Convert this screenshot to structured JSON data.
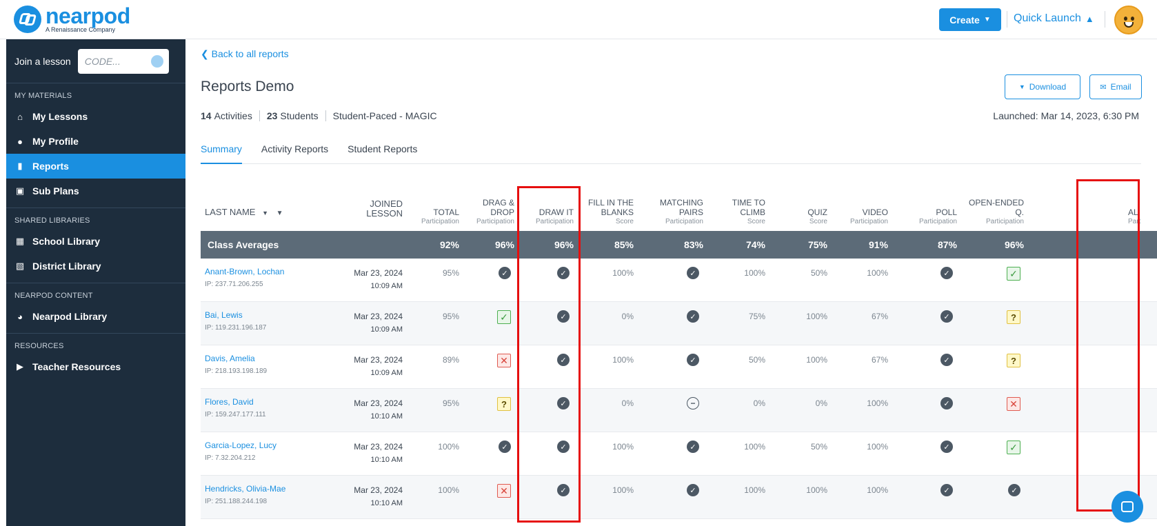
{
  "brand": {
    "name": "nearpod",
    "tagline": "A Renaissance Company"
  },
  "header": {
    "create_label": "Create",
    "quick_launch_label": "Quick Launch"
  },
  "sidebar": {
    "join_label": "Join a lesson",
    "code_placeholder": "CODE...",
    "sections": {
      "my_materials": "MY MATERIALS",
      "shared": "SHARED LIBRARIES",
      "content": "NEARPOD CONTENT",
      "resources": "RESOURCES"
    },
    "items": {
      "my_lessons": "My Lessons",
      "my_profile": "My Profile",
      "reports": "Reports",
      "sub_plans": "Sub Plans",
      "school_library": "School Library",
      "district_library": "District Library",
      "nearpod_library": "Nearpod Library",
      "teacher_resources": "Teacher Resources"
    },
    "active_item": "Reports"
  },
  "report": {
    "back_label": "Back to all reports",
    "title": "Reports Demo",
    "activities_count": "14",
    "activities_label": "Activities",
    "students_count": "23",
    "students_label": "Students",
    "mode": "Student-Paced - MAGIC",
    "launched": "Launched: Mar 14, 2023, 6:30 PM",
    "download_label": "Download",
    "email_label": "Email"
  },
  "tabs": [
    {
      "label": "Summary",
      "active": true
    },
    {
      "label": "Activity Reports",
      "active": false
    },
    {
      "label": "Student Reports",
      "active": false
    }
  ],
  "table": {
    "headers": {
      "last_name": "LAST NAME",
      "joined": "JOINED LESSON",
      "total": "TOTAL",
      "total_sub": "Participation",
      "drag": "DRAG & DROP",
      "drag_sub": "Participation",
      "draw": "DRAW IT",
      "draw_sub": "Participation",
      "fill": "FILL IN THE BLANKS",
      "fill_sub": "Score",
      "match": "MATCHING PAIRS",
      "match_sub": "Participation",
      "climb": "TIME TO CLIMB",
      "climb_sub": "Score",
      "quiz": "QUIZ",
      "quiz_sub": "Score",
      "video": "VIDEO",
      "video_sub": "Participation",
      "poll": "POLL",
      "poll_sub": "Participation",
      "open": "OPEN-ENDED Q.",
      "open_sub": "Participation",
      "partial": "AL",
      "partial_sub": "Part"
    },
    "averages": {
      "label": "Class Averages",
      "total": "92%",
      "drag": "96%",
      "draw": "96%",
      "fill": "85%",
      "match": "83%",
      "climb": "74%",
      "quiz": "75%",
      "video": "91%",
      "poll": "87%",
      "open": "96%"
    },
    "rows": [
      {
        "name": "Anant-Brown, Lochan",
        "ip": "IP: 237.71.206.255",
        "date": "Mar 23, 2024",
        "time": "10:09 AM",
        "total": "95%",
        "drag": "check",
        "draw": "check",
        "fill": "100%",
        "match": "check",
        "climb": "100%",
        "quiz": "50%",
        "video": "100%",
        "poll": "check",
        "open": "correct"
      },
      {
        "name": "Bai, Lewis",
        "ip": "IP: 119.231.196.187",
        "date": "Mar 23, 2024",
        "time": "10:09 AM",
        "total": "95%",
        "drag": "correct",
        "draw": "check",
        "fill": "0%",
        "match": "check",
        "climb": "75%",
        "quiz": "100%",
        "video": "67%",
        "poll": "check",
        "open": "unknown"
      },
      {
        "name": "Davis, Amelia",
        "ip": "IP: 218.193.198.189",
        "date": "Mar 23, 2024",
        "time": "10:09 AM",
        "total": "89%",
        "drag": "wrong",
        "draw": "check",
        "fill": "100%",
        "match": "check",
        "climb": "50%",
        "quiz": "100%",
        "video": "67%",
        "poll": "check",
        "open": "unknown"
      },
      {
        "name": "Flores, David",
        "ip": "IP: 159.247.177.111",
        "date": "Mar 23, 2024",
        "time": "10:10 AM",
        "total": "95%",
        "drag": "unknown",
        "draw": "check",
        "fill": "0%",
        "match": "skip",
        "climb": "0%",
        "quiz": "0%",
        "video": "100%",
        "poll": "check",
        "open": "wrong"
      },
      {
        "name": "Garcia-Lopez, Lucy",
        "ip": "IP: 7.32.204.212",
        "date": "Mar 23, 2024",
        "time": "10:10 AM",
        "total": "100%",
        "drag": "check",
        "draw": "check",
        "fill": "100%",
        "match": "check",
        "climb": "100%",
        "quiz": "50%",
        "video": "100%",
        "poll": "check",
        "open": "correct"
      },
      {
        "name": "Hendricks, Olivia-Mae",
        "ip": "IP: 251.188.244.198",
        "date": "Mar 23, 2024",
        "time": "10:10 AM",
        "total": "100%",
        "drag": "wrong",
        "draw": "check",
        "fill": "100%",
        "match": "check",
        "climb": "100%",
        "quiz": "100%",
        "video": "100%",
        "poll": "check",
        "open": "check"
      }
    ]
  },
  "icons": {
    "check": "filled-check-circle-icon",
    "correct": "correct-check-box-icon",
    "wrong": "incorrect-x-box-icon",
    "unknown": "question-box-icon",
    "skip": "minus-circle-icon"
  },
  "colors": {
    "accent": "#1a8fe0",
    "sidebar": "#1d2d3d",
    "average_row": "#5c6b78",
    "highlight": "#e60e0e"
  }
}
